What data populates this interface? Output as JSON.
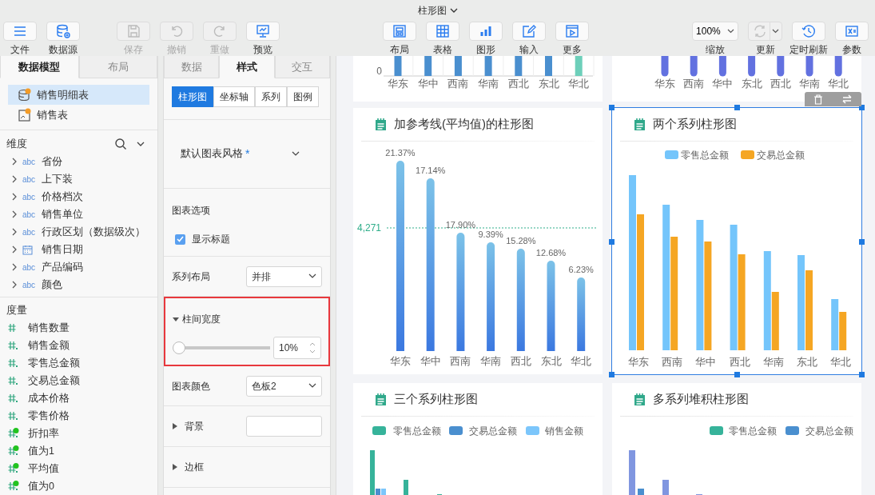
{
  "window": {
    "title": "柱形图"
  },
  "toolbar": {
    "left": [
      {
        "label": "文件",
        "disabled": false
      },
      {
        "label": "数据源",
        "disabled": false
      },
      {
        "label": "保存",
        "disabled": true
      },
      {
        "label": "撤销",
        "disabled": true
      },
      {
        "label": "重做",
        "disabled": true
      },
      {
        "label": "预览",
        "disabled": false
      }
    ],
    "center": [
      {
        "label": "布局",
        "disabled": false
      },
      {
        "label": "表格",
        "disabled": false
      },
      {
        "label": "图形",
        "disabled": false
      },
      {
        "label": "输入",
        "disabled": false
      },
      {
        "label": "更多",
        "disabled": false
      }
    ],
    "right": [
      {
        "kind": "dropdown",
        "label": "缩放",
        "value": "100%"
      },
      {
        "kind": "split",
        "label": "更新",
        "disabled": true
      },
      {
        "kind": "button",
        "label": "定时刷新",
        "disabled": false
      },
      {
        "kind": "button",
        "label": "参数",
        "disabled": false
      }
    ]
  },
  "left_panel": {
    "tabs": [
      {
        "label": "数据模型",
        "selected": true
      },
      {
        "label": "布局",
        "selected": false
      }
    ],
    "tables": [
      {
        "kind": "detail",
        "label": "销售明细表",
        "selected": true
      },
      {
        "kind": "table",
        "label": "销售表",
        "selected": false
      }
    ],
    "dimensions": {
      "title": "维度",
      "items": [
        {
          "kind": "text",
          "badge": "abc",
          "label": "省份",
          "expanded": false
        },
        {
          "kind": "text",
          "badge": "abc",
          "label": "上下装",
          "expanded": false
        },
        {
          "kind": "text",
          "badge": "abc",
          "label": "价格档次",
          "expanded": false
        },
        {
          "kind": "text",
          "badge": "abc",
          "label": "销售单位",
          "expanded": false
        },
        {
          "kind": "text",
          "badge": "abc",
          "label": "行政区划（数据级次）",
          "expanded": false
        },
        {
          "kind": "date",
          "label": "销售日期",
          "expanded": false
        },
        {
          "kind": "text",
          "badge": "abc",
          "label": "产品编码",
          "expanded": false
        },
        {
          "kind": "text",
          "badge": "abc",
          "label": "颜色",
          "expanded": false
        }
      ]
    },
    "measures": {
      "title": "度量",
      "items": [
        {
          "kind": "integer",
          "label": "销售数量"
        },
        {
          "kind": "decimal",
          "label": "销售金额"
        },
        {
          "kind": "decimal",
          "label": "零售总金额"
        },
        {
          "kind": "decimal",
          "label": "交易总金额"
        },
        {
          "kind": "decimal",
          "label": "成本价格"
        },
        {
          "kind": "decimal",
          "label": "零售价格"
        },
        {
          "kind": "calculated",
          "label": "折扣率"
        },
        {
          "kind": "calculated",
          "label": "值为1"
        },
        {
          "kind": "calculated",
          "label": "平均值"
        },
        {
          "kind": "calculated",
          "label": "值为0"
        }
      ]
    }
  },
  "style_panel": {
    "tabs": [
      {
        "label": "数据",
        "selected": false
      },
      {
        "label": "样式",
        "selected": true
      },
      {
        "label": "交互",
        "selected": false
      }
    ],
    "subtabs": [
      {
        "label": "柱形图",
        "selected": true
      },
      {
        "label": "坐标轴",
        "selected": false
      },
      {
        "label": "系列",
        "selected": false
      },
      {
        "label": "图例",
        "selected": false
      }
    ],
    "theme": {
      "value": "默认图表风格",
      "required_mark": "*"
    },
    "options_title": "图表选项",
    "show_title": {
      "label": "显示标题",
      "checked": true
    },
    "series_layout": {
      "label": "系列布局",
      "value": "并排"
    },
    "bar_gap": {
      "label": "柱间宽度",
      "expanded": true,
      "highlighted": true,
      "level": 0,
      "value": "10%"
    },
    "chart_color": {
      "label": "图表颜色",
      "value": "色板2"
    },
    "background": {
      "label": "背景",
      "expanded": false
    },
    "border": {
      "label": "边框",
      "expanded": false
    }
  },
  "canvas": {
    "charts": [
      {
        "kind": "tail",
        "selected": false,
        "axis_label": "0",
        "categories": [
          "华东",
          "华中",
          "西南",
          "华南",
          "西北",
          "东北",
          "华北"
        ]
      },
      {
        "kind": "tail_rounded",
        "selected": false,
        "categories": [
          "华东",
          "西南",
          "华中",
          "东北",
          "西北",
          "华南",
          "华北"
        ]
      },
      {
        "kind": "reference",
        "title": "加参考线(平均值)的柱形图",
        "selected": false,
        "categories": [
          "华东",
          "华中",
          "西南",
          "华南",
          "西北",
          "东北",
          "华北"
        ],
        "value_labels": [
          "21.37%",
          "17.14%",
          "17.90%",
          "9.39%",
          "15.28%",
          "12.68%",
          "6.23%"
        ],
        "reference_label": "4,271"
      },
      {
        "kind": "grouped",
        "title": "两个系列柱形图",
        "selected": true,
        "legend": [
          {
            "name": "零售总金额",
            "color": "#74c5fb"
          },
          {
            "name": "交易总金额",
            "color": "#f5a623"
          }
        ],
        "categories": [
          "华东",
          "西南",
          "华中",
          "西北",
          "华南",
          "东北",
          "华北"
        ]
      },
      {
        "kind": "triple",
        "title": "三个系列柱形图",
        "selected": false,
        "legend": [
          {
            "name": "零售总金额",
            "color": "#36b39a"
          },
          {
            "name": "交易总金额",
            "color": "#4a8fcf"
          },
          {
            "name": "销售金额",
            "color": "#7cc6fb"
          }
        ]
      },
      {
        "kind": "stacked",
        "title": "多系列堆积柱形图",
        "selected": false,
        "legend": [
          {
            "name": "零售总金额",
            "color": "#36b39a"
          },
          {
            "name": "交易总金额",
            "color": "#4a8fcf"
          }
        ]
      }
    ]
  }
}
